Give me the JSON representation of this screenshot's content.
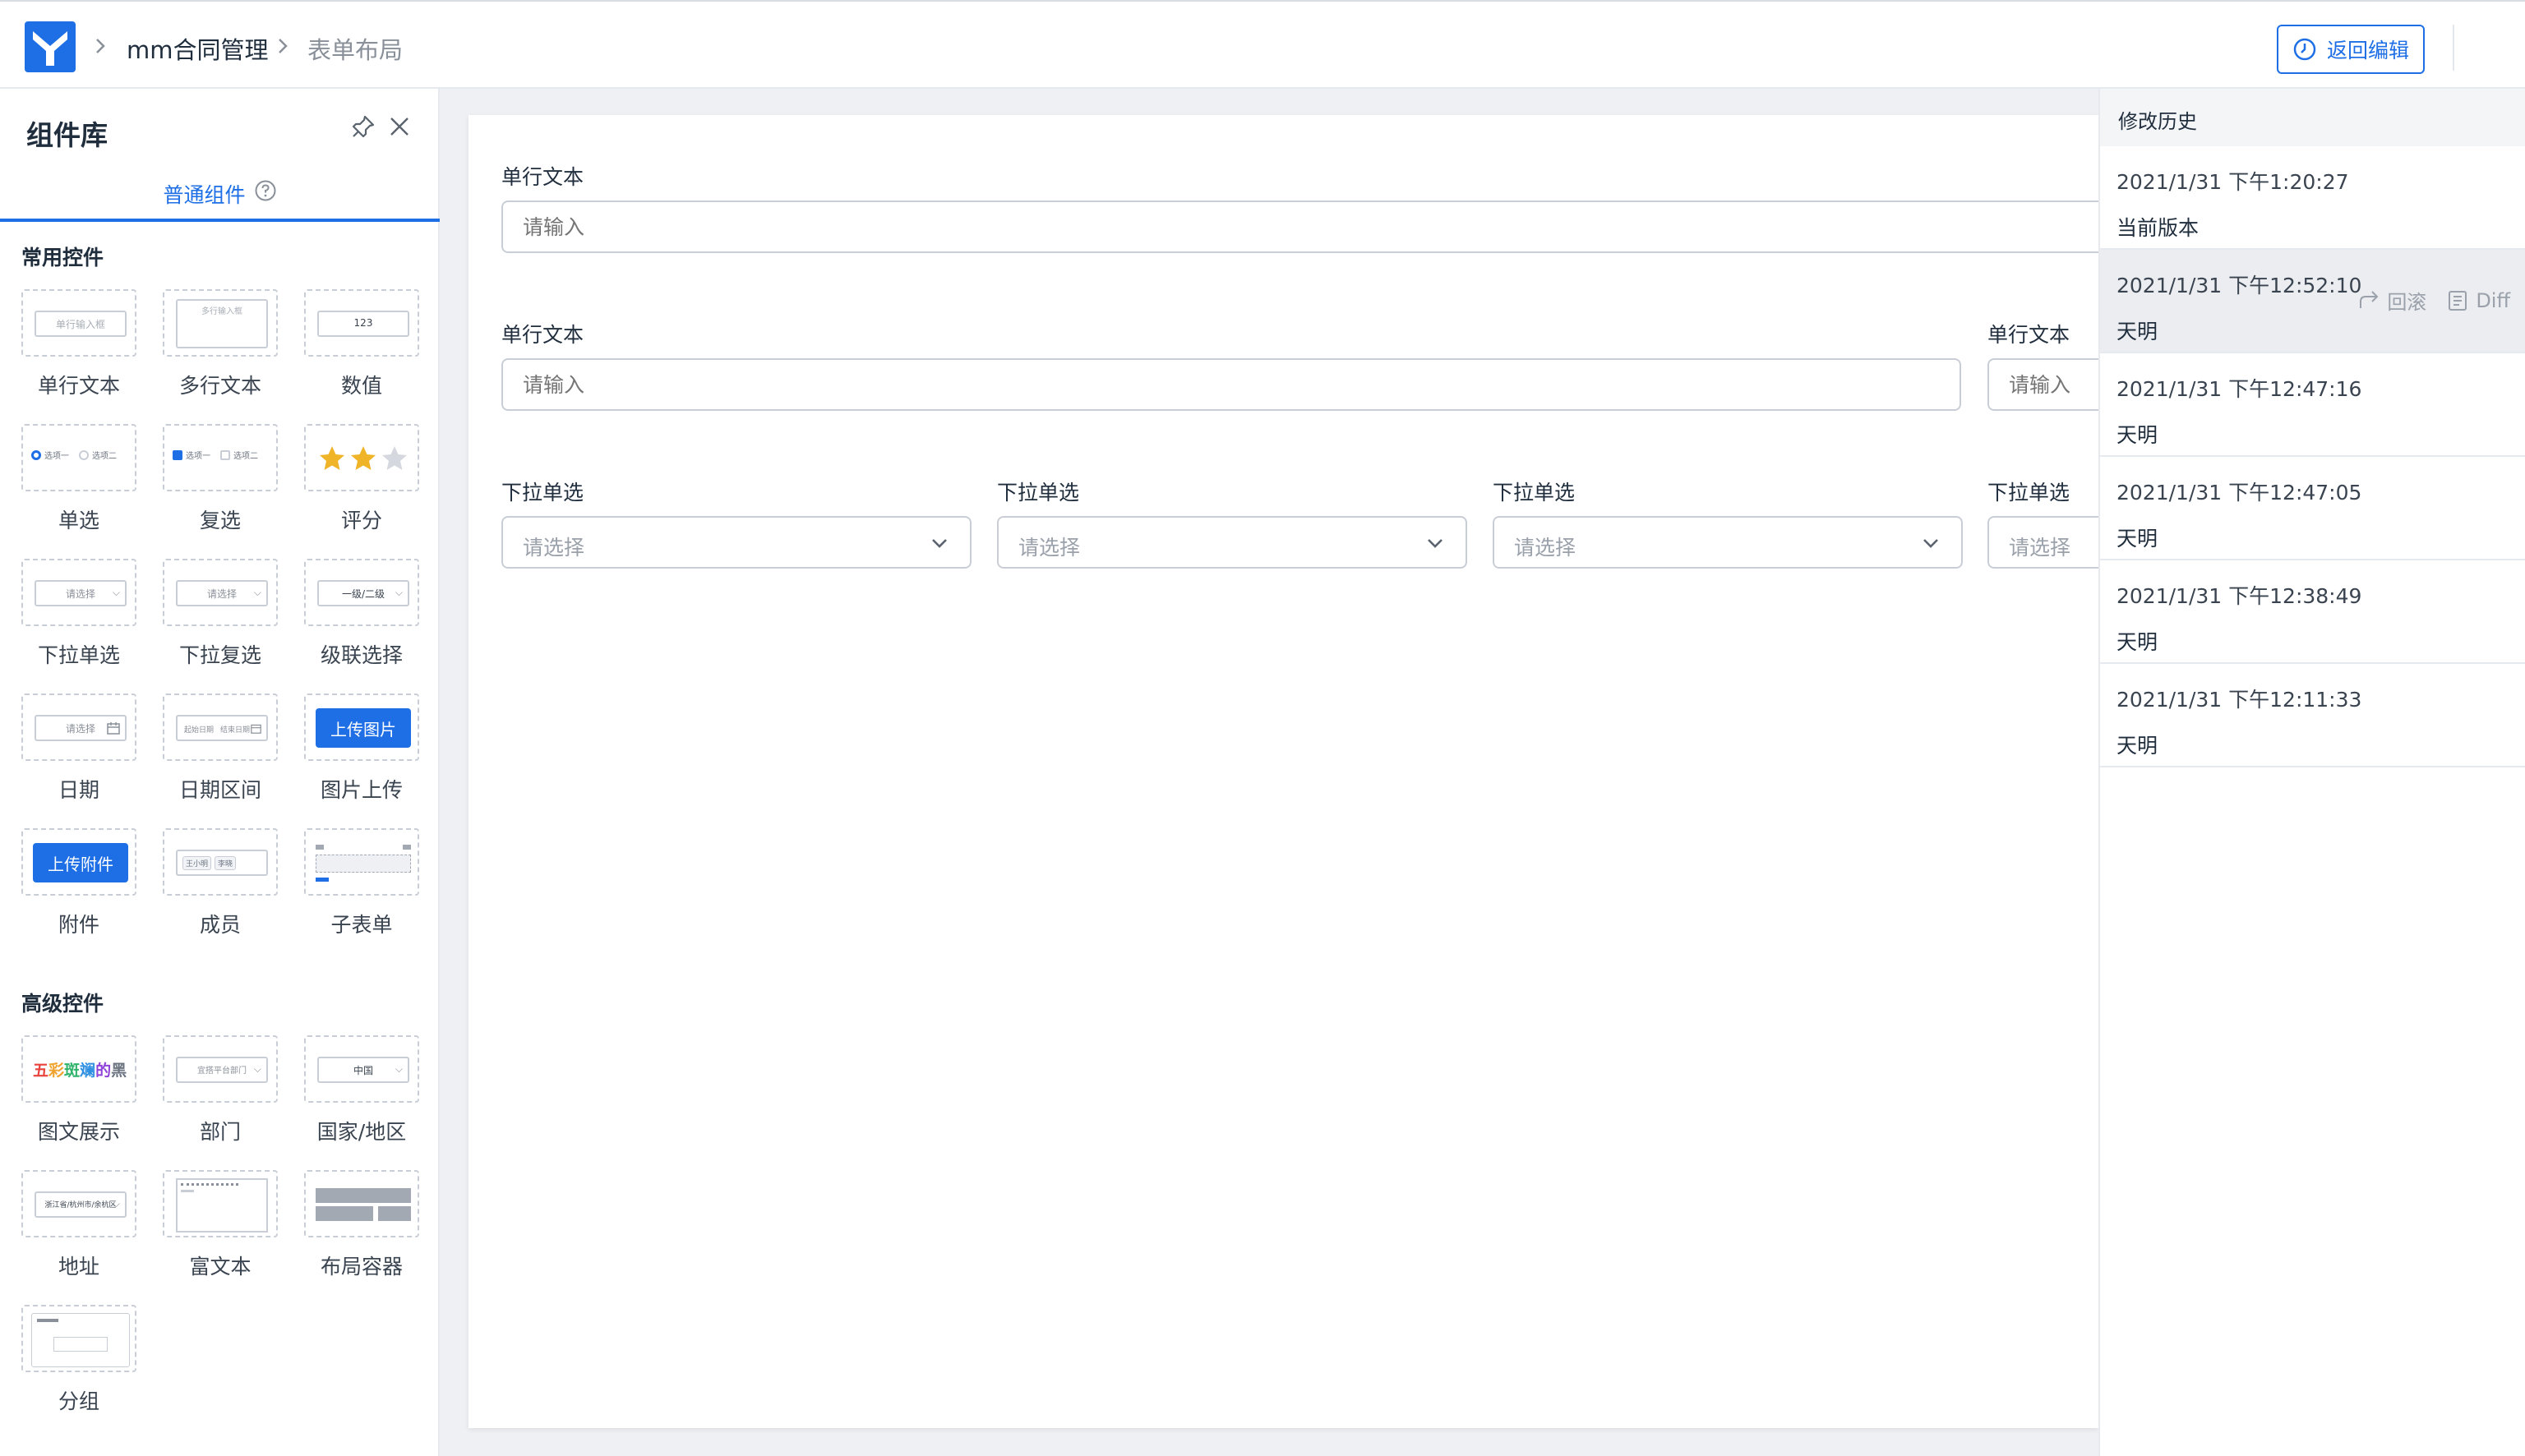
{
  "header": {
    "app_name": "mm合同管理",
    "page_name": "表单布局",
    "back_edit_label": "返回编辑",
    "brand_color": "#1e6fe6"
  },
  "left_panel": {
    "title": "组件库",
    "tab_label": "普通组件",
    "sections": {
      "common": "常用控件",
      "advanced": "高级控件"
    },
    "components": {
      "single_text": "单行文本",
      "multi_text": "多行文本",
      "number": "数值",
      "radio": "单选",
      "checkbox": "复选",
      "rating": "评分",
      "dropdown_single": "下拉单选",
      "dropdown_multi": "下拉复选",
      "cascade": "级联选择",
      "date": "日期",
      "date_range": "日期区间",
      "image_upload": "图片上传",
      "attachment": "附件",
      "member": "成员",
      "sub_form": "子表单",
      "image_text": "图文展示",
      "department": "部门",
      "country": "国家/地区",
      "address": "地址",
      "rich_text": "富文本",
      "layout_container": "布局容器",
      "group": "分组"
    },
    "thumbs": {
      "single_text_ph": "单行输入框",
      "multi_text_ph": "多行输入框",
      "number_value": "123",
      "option_one": "选项一",
      "option_two": "选项二",
      "select_ph": "请选择",
      "cascade_value": "一级/二级",
      "date_start": "起始日期",
      "date_end": "结束日期",
      "image_upload_btn": "上传图片",
      "attachment_btn": "上传附件",
      "member_a": "王小明",
      "member_b": "李晓",
      "rainbow": [
        "五",
        "彩",
        "斑",
        "斓",
        "的",
        "黑"
      ],
      "rainbow_colors": [
        "#e8433d",
        "#f0a22e",
        "#2fb36a",
        "#2f8fe0",
        "#8e44d8",
        "#6b7480"
      ],
      "department_ph": "宜搭平台部门",
      "country_value": "中国",
      "address_value": "浙江省/杭州市/余杭区",
      "rating_value": 2,
      "rating_max": 3
    }
  },
  "canvas": {
    "row1": {
      "label": "单行文本",
      "placeholder": "请输入"
    },
    "row2": [
      {
        "label": "单行文本",
        "placeholder": "请输入"
      },
      {
        "label": "单行文本",
        "placeholder": "请输入"
      }
    ],
    "row3": [
      {
        "label": "下拉单选",
        "placeholder": "请选择"
      },
      {
        "label": "下拉单选",
        "placeholder": "请选择"
      },
      {
        "label": "下拉单选",
        "placeholder": "请选择"
      },
      {
        "label": "下拉单选",
        "placeholder": "请选择"
      }
    ]
  },
  "history": {
    "title": "修改历史",
    "rollback_label": "回滚",
    "diff_label": "Diff",
    "items": [
      {
        "time": "2021/1/31 下午1:20:27",
        "user": "当前版本"
      },
      {
        "time": "2021/1/31 下午12:52:10",
        "user": "天明"
      },
      {
        "time": "2021/1/31 下午12:47:16",
        "user": "天明"
      },
      {
        "time": "2021/1/31 下午12:47:05",
        "user": "天明"
      },
      {
        "time": "2021/1/31 下午12:38:49",
        "user": "天明"
      },
      {
        "time": "2021/1/31 下午12:11:33",
        "user": "天明"
      }
    ]
  }
}
